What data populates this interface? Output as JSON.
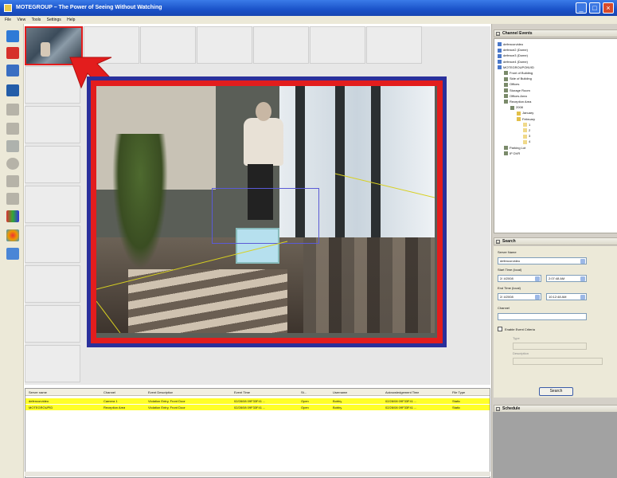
{
  "window": {
    "title": "MOTEGROUP – The Power of Seeing Without Watching",
    "minimize": "_",
    "maximize": "□",
    "close": "×"
  },
  "menu": [
    "File",
    "View",
    "Tools",
    "Settings",
    "Help"
  ],
  "toolbar_icons": [
    "camera-icon",
    "record-icon",
    "monitor-icon",
    "screen-icon",
    "grid-icon",
    "layout-icon",
    "pen-icon",
    "circle-icon",
    "list-icon",
    "scissors-icon",
    "chart-icon",
    "palette-icon",
    "pin-icon"
  ],
  "channel_events": {
    "header": "Channel Events",
    "items": [
      {
        "label": "defencorvideo",
        "indent": 0
      },
      {
        "label": "defence2 (Dome)",
        "indent": 0
      },
      {
        "label": "defence3 (Dome)",
        "indent": 0
      },
      {
        "label": "defence4 (Dome)",
        "indent": 0
      },
      {
        "label": "MOTEGROUPONVID",
        "indent": 0
      },
      {
        "label": "Front of Building",
        "indent": 1
      },
      {
        "label": "Side of Building",
        "indent": 1
      },
      {
        "label": "Offices",
        "indent": 1
      },
      {
        "label": "Storage Room",
        "indent": 1
      },
      {
        "label": "Offices Area",
        "indent": 1
      },
      {
        "label": "Reception Area",
        "indent": 1
      },
      {
        "label": "2008",
        "indent": 2
      },
      {
        "label": "January",
        "indent": 3
      },
      {
        "label": "February",
        "indent": 3
      },
      {
        "label": "1",
        "indent": 4
      },
      {
        "label": "2",
        "indent": 4
      },
      {
        "label": "3",
        "indent": 4
      },
      {
        "label": "4",
        "indent": 4
      },
      {
        "label": "Parking Lot",
        "indent": 1
      },
      {
        "label": "IP DVR",
        "indent": 1
      }
    ]
  },
  "search": {
    "header": "Search",
    "server_label": "Server Name",
    "server_value": "defencorvideo",
    "start_label": "Start Time (local)",
    "start_date": "2/ 4/2008",
    "start_time": "2:07:48 AM",
    "end_label": "End Time (local)",
    "end_date": "2/ 4/2008",
    "end_time": "10:12:48 AM",
    "channel_label": "Channel",
    "channel_value": "",
    "enable_criteria": "Enable Event Criteria",
    "type_label": "Type",
    "type_value": "",
    "description_label": "Description",
    "description_value": "",
    "button": "Search"
  },
  "schedule": {
    "header": "Schedule"
  },
  "results": {
    "columns": [
      "Server name",
      "Channel",
      "Event Description",
      "Event Time",
      "St...",
      "Username",
      "Acknowledgement Time",
      "File Type"
    ],
    "rows": [
      [
        "defencorvideo",
        "Camera 1",
        "Violation Entry, Front Door",
        "02/28/08 09F33F41 ...",
        "Open",
        "Bobby",
        "02/28/08 09F33F41 ...",
        "Static"
      ],
      [
        "MOTEGROUPID",
        "Reception Area",
        "Violation Entry, Front Door",
        "02/28/08 09F33F41 ...",
        "Open",
        "Bobby",
        "02/28/08 09F33F41 ...",
        "Static"
      ]
    ]
  },
  "colors": {
    "accent_red": "#e31d1d",
    "frame_blue": "#2a2f9b",
    "row_highlight": "#ffff29"
  }
}
